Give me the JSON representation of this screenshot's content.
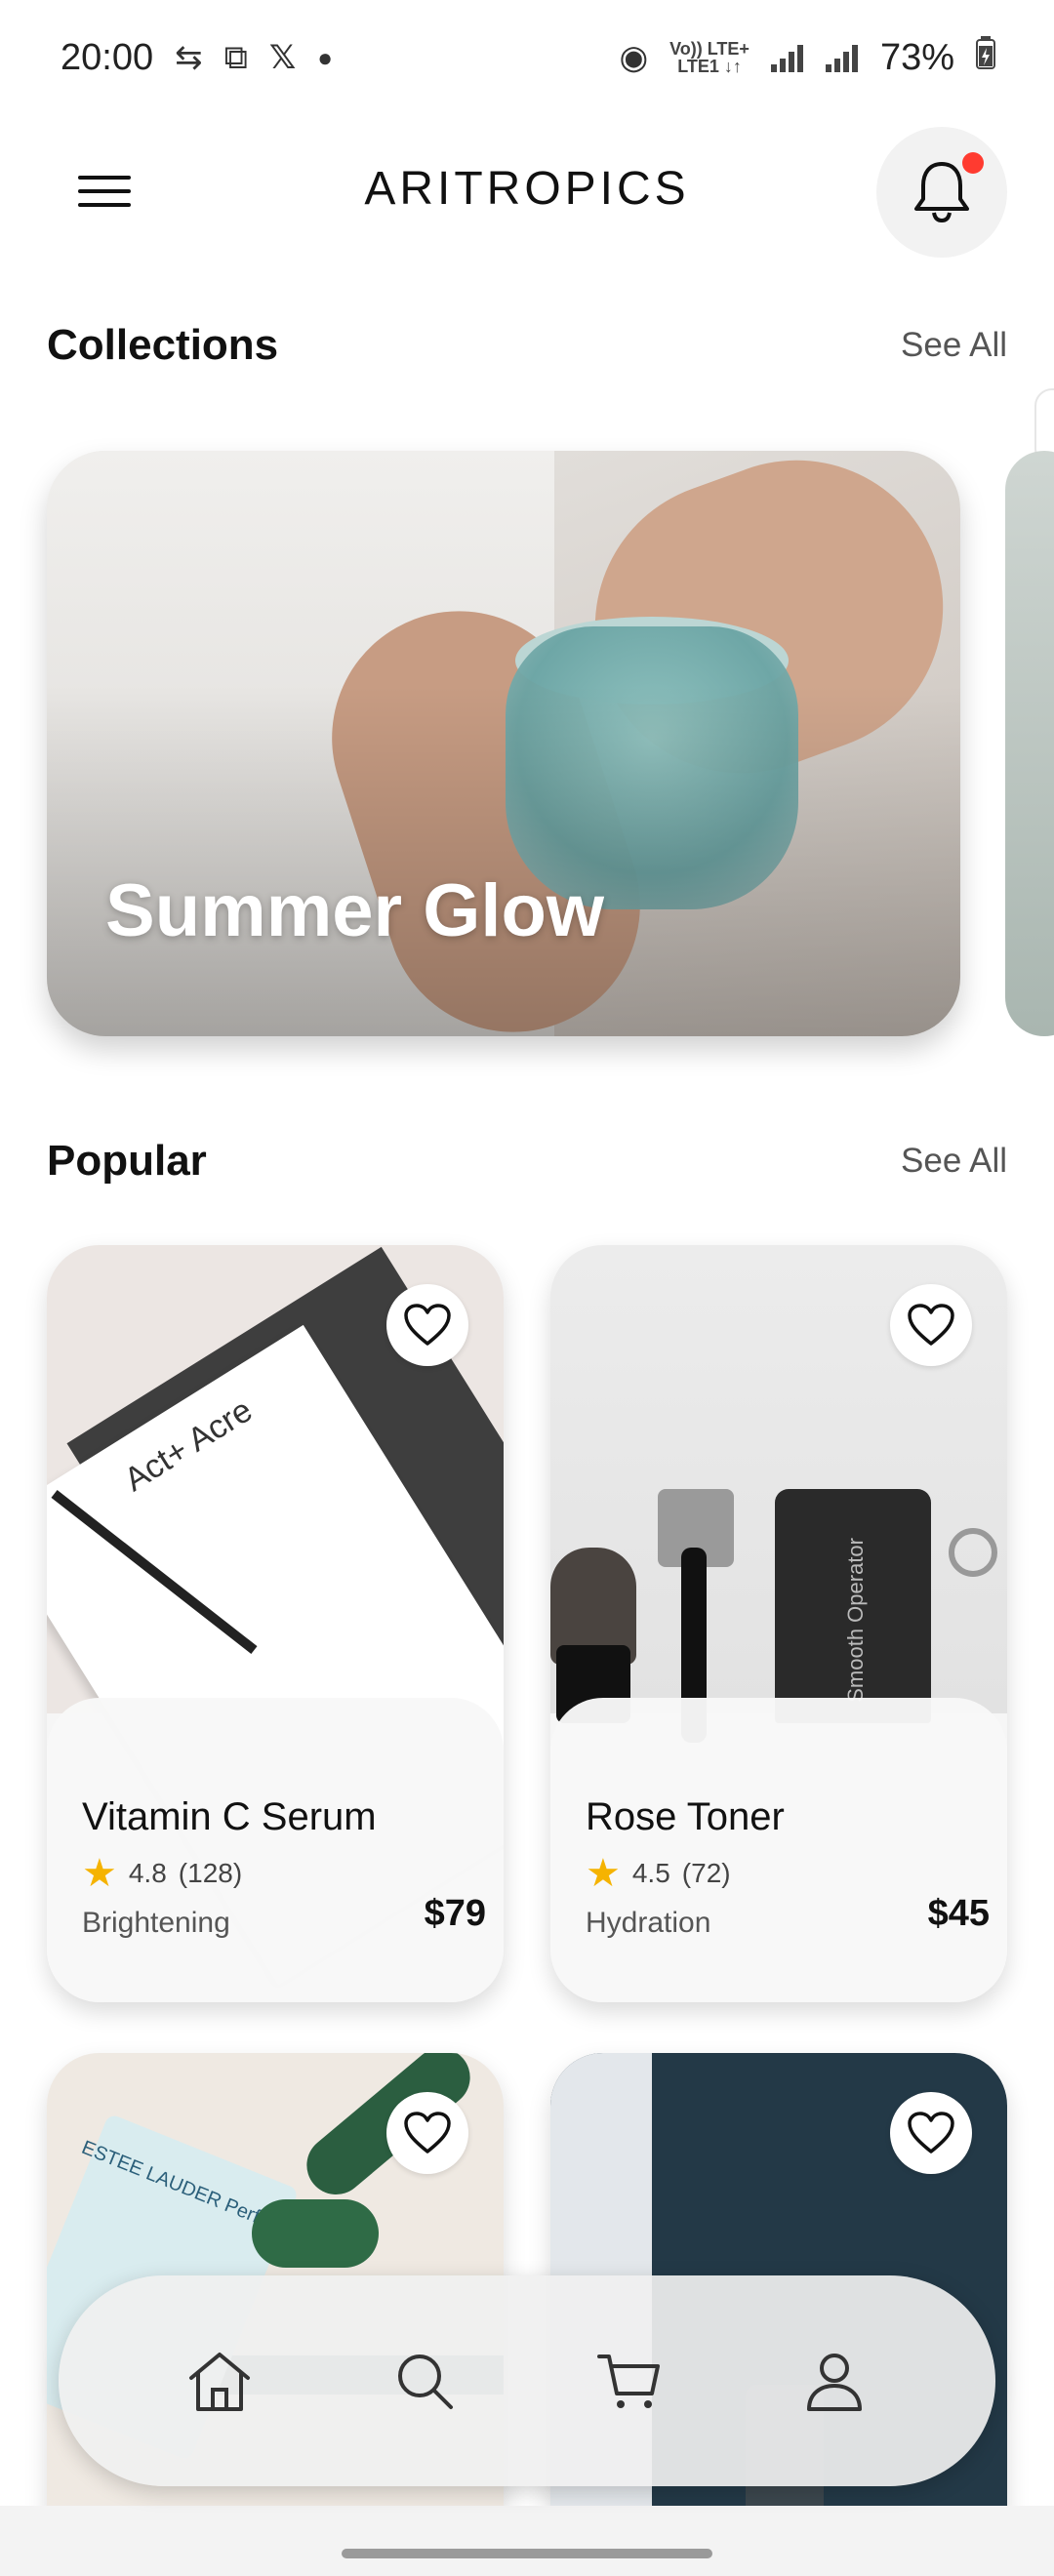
{
  "status_bar": {
    "time": "20:00",
    "battery": "73%",
    "volte_top": "Vo)) LTE+",
    "volte_bottom": "LTE1 ↓↑",
    "icons": [
      "sync-icon",
      "screen-record-icon",
      "x-icon",
      "dot-icon",
      "hotspot-icon",
      "signal-icon",
      "signal-icon",
      "battery-charging-icon"
    ]
  },
  "header": {
    "title": "ARITROPICS",
    "menu_icon": "hamburger-menu-icon",
    "notification_icon": "bell-icon",
    "notification_dot_color": "#ff3b30"
  },
  "collections": {
    "title": "Collections",
    "see_all": "See All",
    "items": [
      {
        "title": "Summer Glow"
      }
    ]
  },
  "popular": {
    "title": "Popular",
    "see_all": "See All",
    "products": [
      {
        "name": "Vitamin C Serum",
        "rating": "4.8",
        "reviews": "(128)",
        "category": "Brightening",
        "price": "$79",
        "image_text": "Act+ Acre"
      },
      {
        "name": "Rose Toner",
        "rating": "4.5",
        "reviews": "(72)",
        "category": "Hydration",
        "price": "$45",
        "image_text": "Smooth Operator"
      },
      {
        "name": "",
        "image_text": "ESTEE LAUDER Perfectly Clean"
      },
      {
        "name": "",
        "image_text": ""
      }
    ]
  },
  "bottom_nav": {
    "items": [
      "home-icon",
      "search-icon",
      "cart-icon",
      "profile-icon"
    ]
  },
  "colors": {
    "accent": "#111111",
    "star": "#f5b301",
    "background": "#ffffff"
  }
}
